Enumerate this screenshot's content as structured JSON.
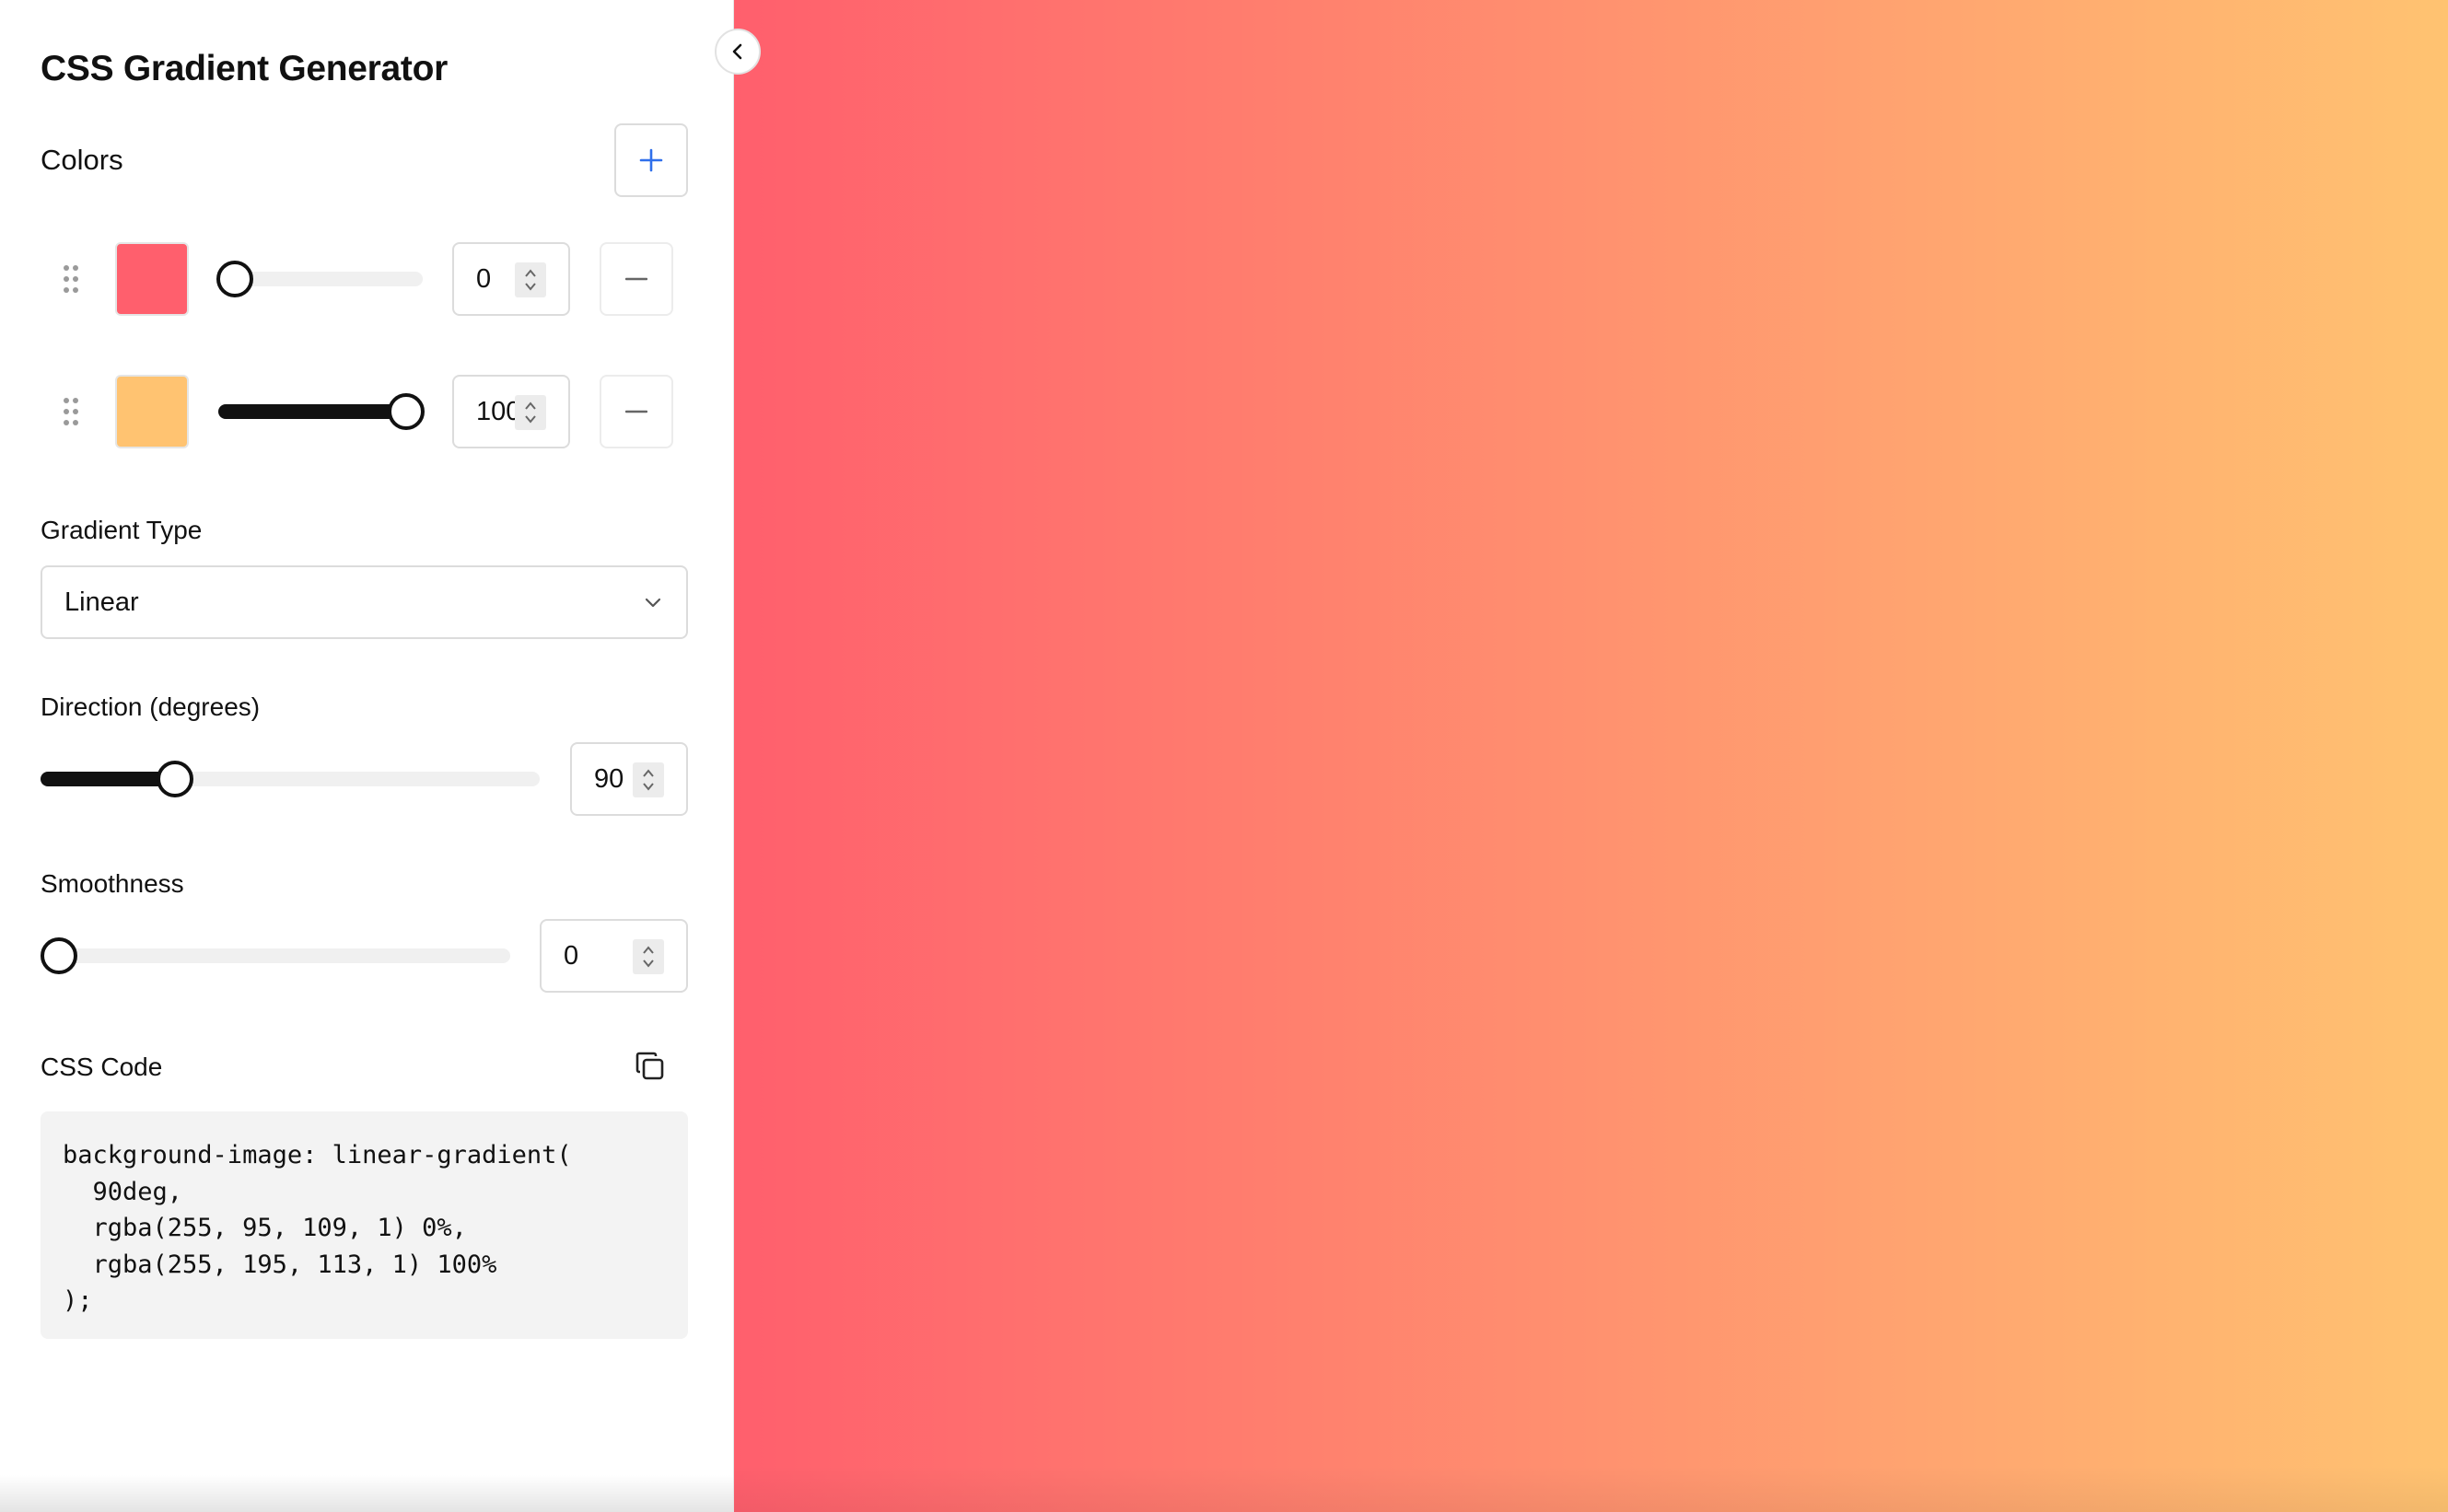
{
  "app": {
    "title": "CSS Gradient Generator"
  },
  "colors_section": {
    "title": "Colors",
    "add_icon": "plus-icon",
    "remove_icon": "minus-icon",
    "drag_icon": "drag-handle-icon",
    "stops": [
      {
        "color": "#FF5F6D",
        "position": 0,
        "position_display": "0"
      },
      {
        "color": "#FFC371",
        "position": 100,
        "position_display": "100"
      }
    ]
  },
  "gradient_type": {
    "label": "Gradient Type",
    "selected": "Linear"
  },
  "direction": {
    "label": "Direction (degrees)",
    "value": 90,
    "value_display": "90",
    "max": 360
  },
  "smoothness": {
    "label": "Smoothness",
    "value": 0,
    "value_display": "0",
    "max": 100
  },
  "css_code": {
    "label": "CSS Code",
    "copy_icon": "copy-icon",
    "code": "background-image: linear-gradient(\n  90deg,\n  rgba(255, 95, 109, 1) 0%,\n  rgba(255, 195, 113, 1) 100%\n);"
  },
  "preview": {
    "gradient": "linear-gradient(90deg, rgba(255, 95, 109, 1) 0%, rgba(255, 195, 113, 1) 100%)"
  },
  "collapse_icon": "chevron-left-icon",
  "theme": {
    "accent": "#2F6FEB",
    "slider_fill": "#111111"
  }
}
